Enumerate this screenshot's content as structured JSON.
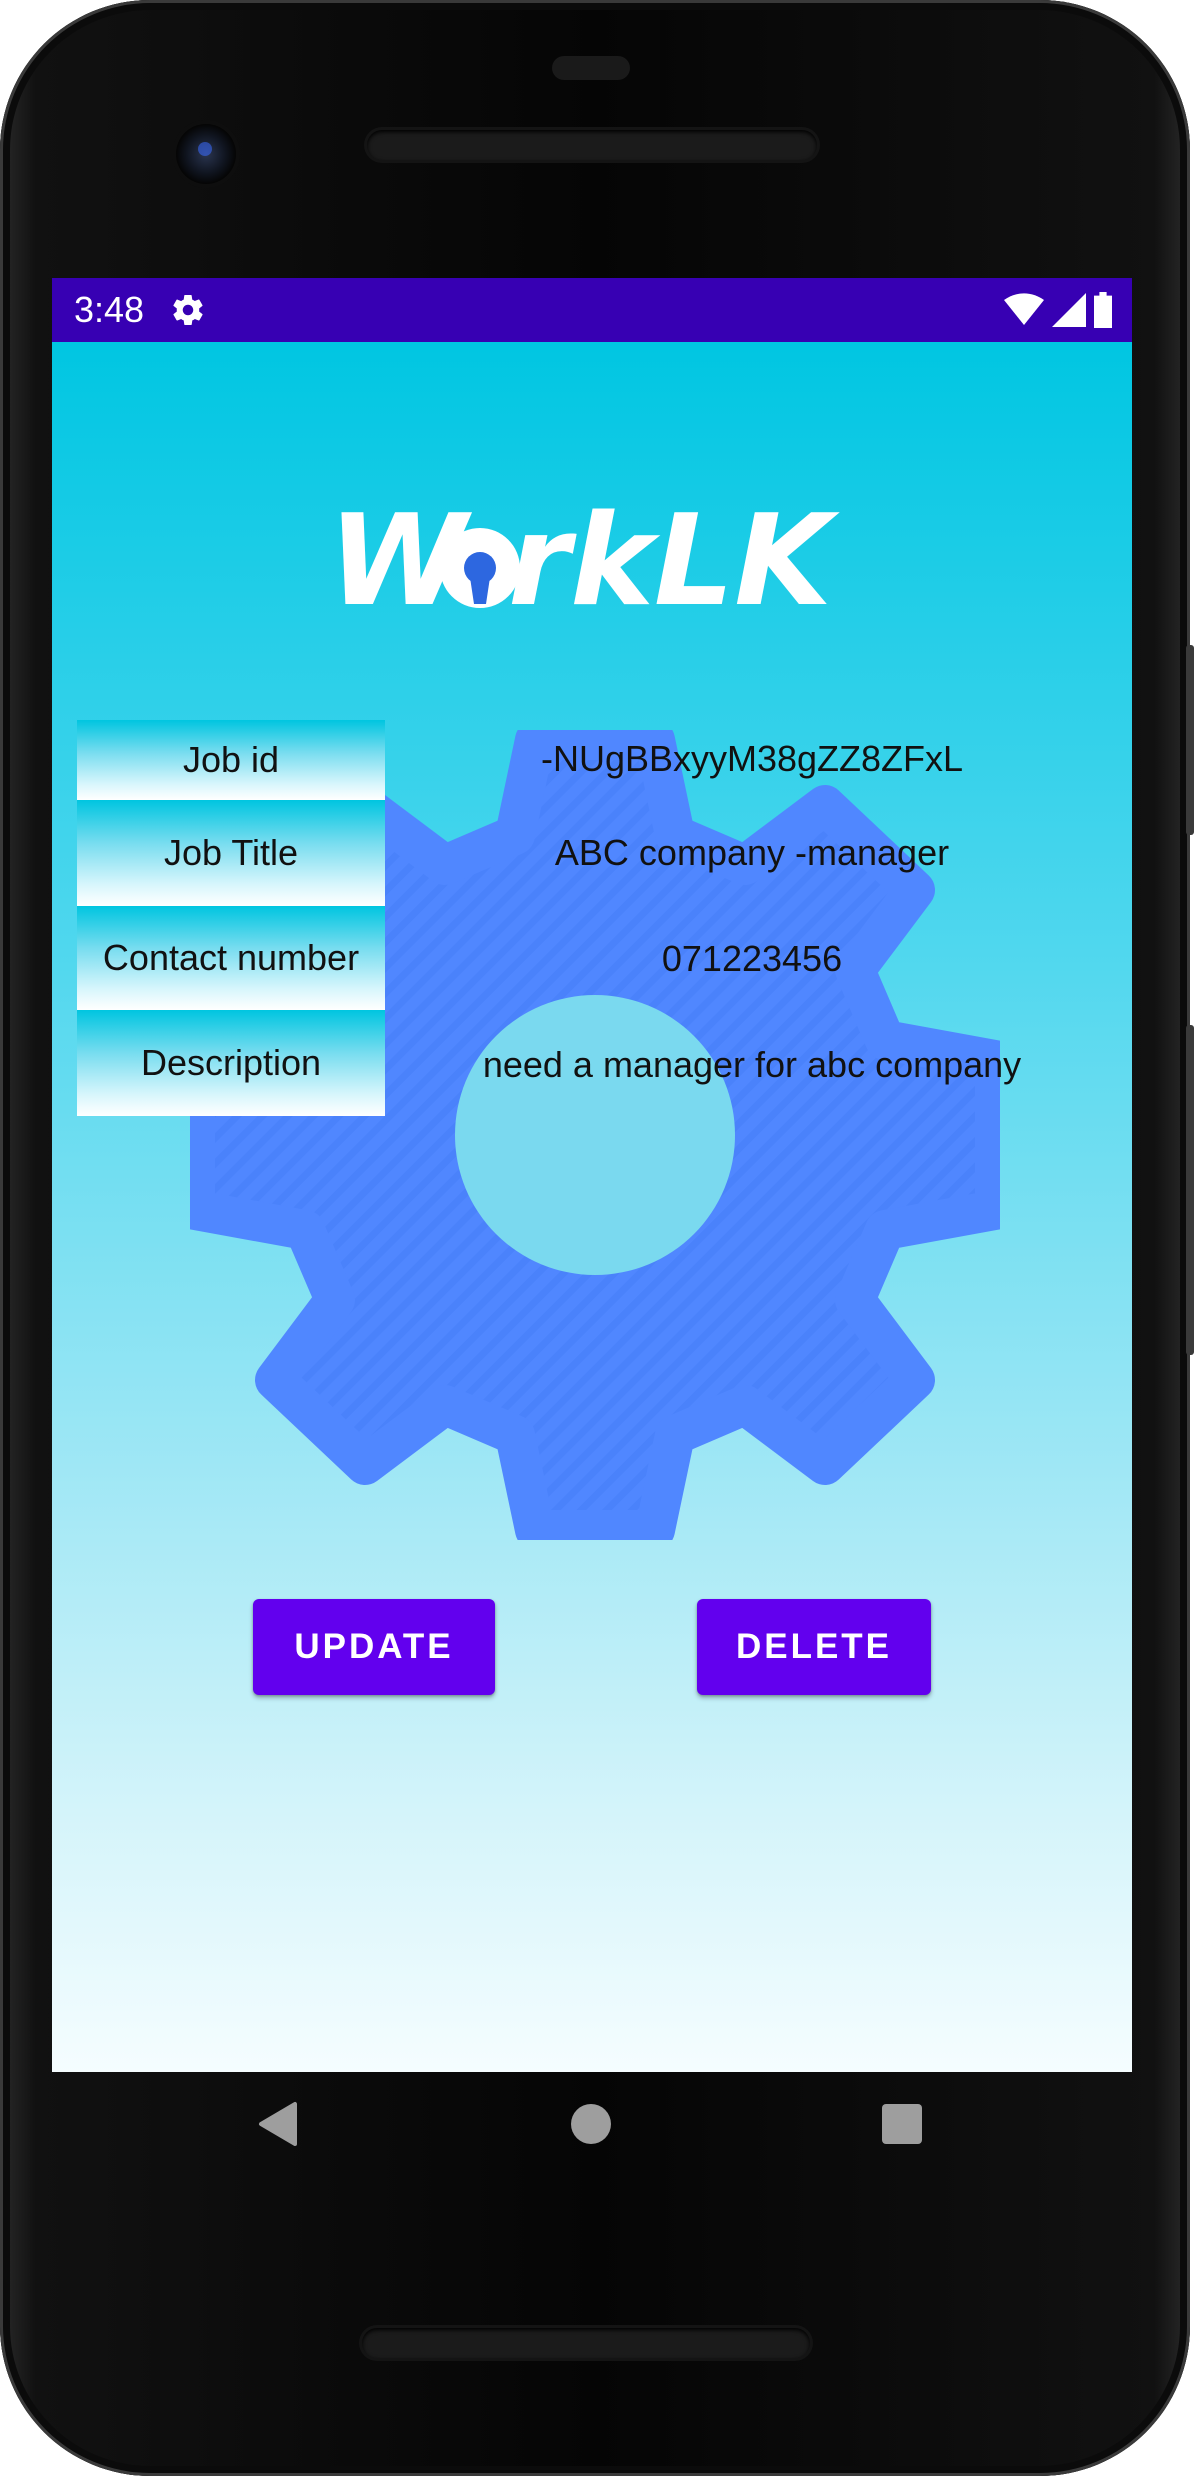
{
  "status_bar": {
    "time": "3:48",
    "icons": [
      "gear-icon",
      "wifi-icon",
      "signal-icon",
      "battery-icon"
    ],
    "background_color": "#3700b3"
  },
  "app": {
    "logo_text": "WorkLK",
    "background_gradient": [
      "#00c6e2",
      "#f5fdff"
    ],
    "fields": [
      {
        "label": "Job id",
        "value": "-NUgBBxyyM38gZZ8ZFxL"
      },
      {
        "label": "Job Title",
        "value": "ABC company -manager"
      },
      {
        "label": "Contact number",
        "value": "071223456"
      },
      {
        "label": "Description",
        "value": "need a manager for abc company"
      }
    ],
    "buttons": {
      "update_label": "UPDATE",
      "delete_label": "DELETE",
      "color": "#6200ee"
    }
  },
  "nav_bar": {
    "items": [
      "back-icon",
      "home-icon",
      "recents-icon"
    ]
  }
}
